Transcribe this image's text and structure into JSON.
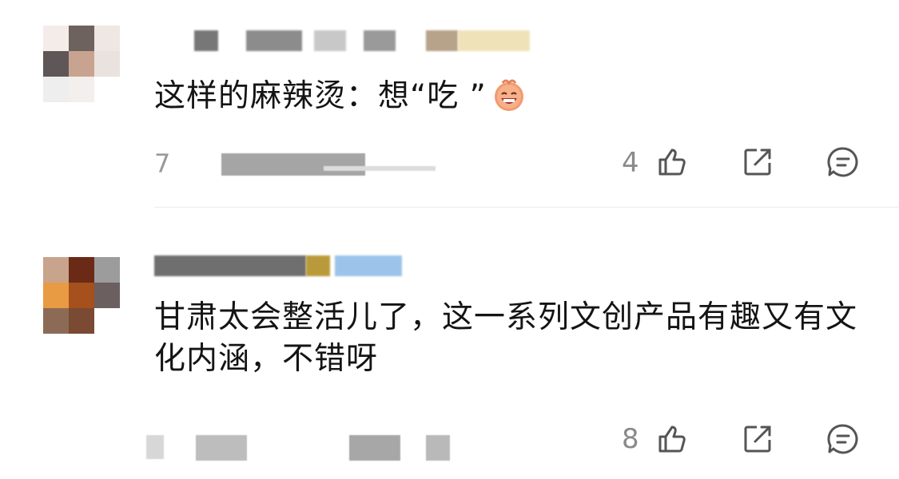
{
  "comments": [
    {
      "text": "这样的麻辣烫：想“吃 ”",
      "emoji": "laughing-face-emoji",
      "meta_fragment": "7",
      "like_count": "4"
    },
    {
      "text": "甘肃太会整活儿了，这一系列文创产品有趣又有文化内涵，不错呀",
      "meta_fragment": "",
      "like_count": "8"
    }
  ],
  "icons": {
    "like": "thumbs-up-icon",
    "share": "share-icon",
    "reply": "comment-icon"
  },
  "colors": {
    "text": "#141414",
    "meta": "#8a8a8a",
    "divider": "#ececec"
  }
}
